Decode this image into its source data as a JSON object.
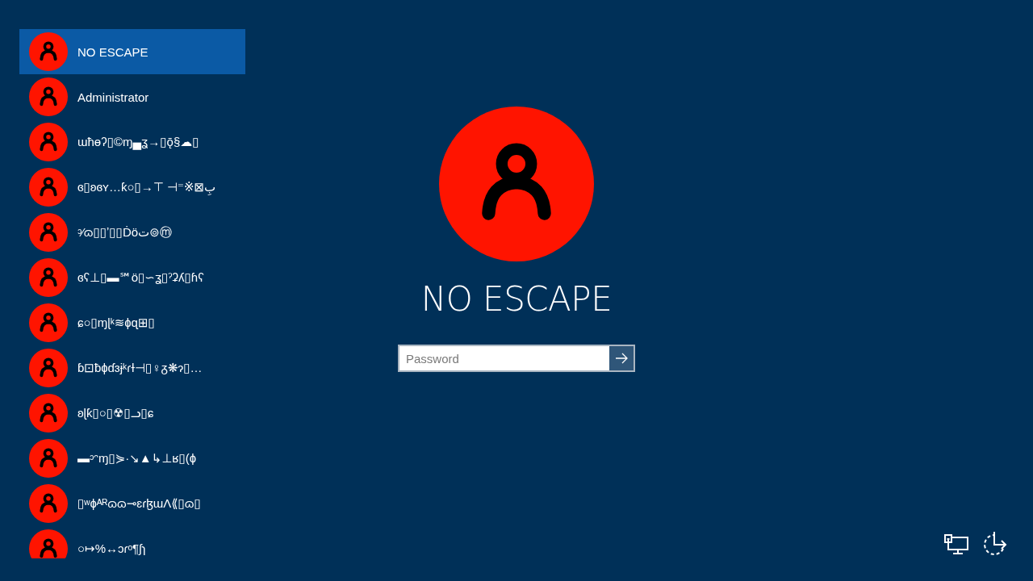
{
  "users": [
    {
      "name": "NO ESCAPE",
      "selected": true
    },
    {
      "name": "Administrator",
      "selected": false
    },
    {
      "name": "ɯħɵʔ▯©ɱ▄ʓ→▯ǭ§☁▯",
      "selected": false
    },
    {
      "name": "ɞ▯ʚɞʏ…ƙ○▯→⊤ ⊣⁼※⊠بِ",
      "selected": false
    },
    {
      "name": "ᵓ⁄ɷ▯▯ʼ▯▯Ḋöت⊚ⓜ",
      "selected": false
    },
    {
      "name": "ɞʕ⊥▯▬℠ö▯∽ʓ▯ˀʡʎ▯ɦʕ",
      "selected": false
    },
    {
      "name": "ɕ○▯ɱɭᵏ≋ɸɋ⊞▯",
      "selected": false
    },
    {
      "name": "ɓ⊡ƀɸɗɜɉᵏɾɫ⊣▯♀ᵹ❋ɂ▯…",
      "selected": false
    },
    {
      "name": "ʚɭƙ▯○▯☢▯ᓗ▯ɕ",
      "selected": false
    },
    {
      "name": "▬ᵓᵔɱ▯⋟·↘▲↳⊥ʁ▯(ɸ",
      "selected": false
    },
    {
      "name": "▯ʷɸᴬᴿɷɷ⊸ɛɾɮɯɅ⟪▯ɷ▯",
      "selected": false
    },
    {
      "name": "○↦%↔ɔɾᵒ¶ʃɿ",
      "selected": false
    }
  ],
  "sign_in": {
    "user_name": "NO ESCAPE",
    "password_field": {
      "placeholder": "Password"
    }
  }
}
